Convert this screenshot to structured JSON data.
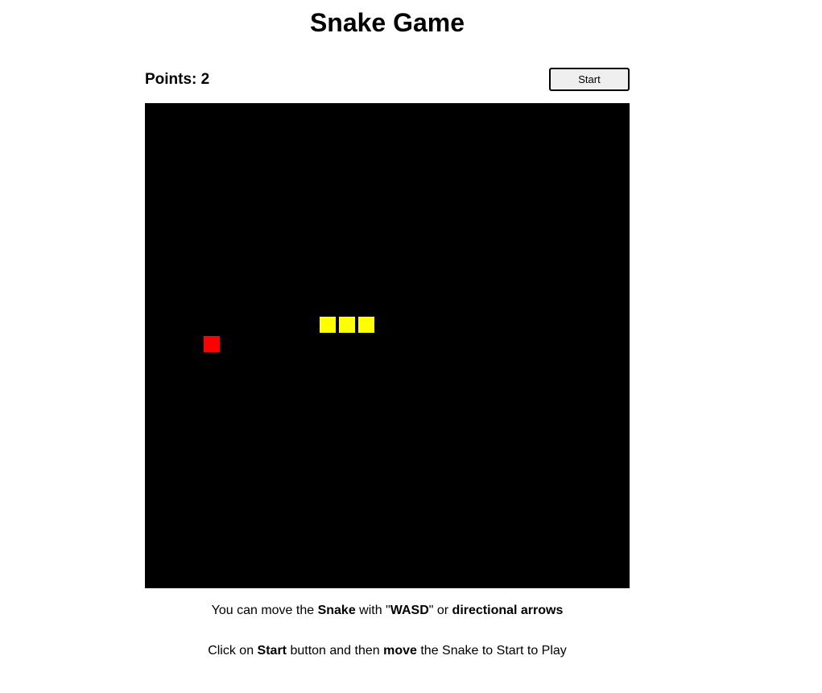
{
  "title": "Snake Game",
  "score": {
    "text": "Points: 2"
  },
  "controls": {
    "start_label": "Start"
  },
  "board": {
    "grid_cols": 25,
    "grid_rows": 25,
    "background": "#000000",
    "snake_color": "#ffff00",
    "food_color": "#ff0000",
    "snake": [
      {
        "col": 9,
        "row": 11
      },
      {
        "col": 10,
        "row": 11
      },
      {
        "col": 11,
        "row": 11
      }
    ],
    "food": {
      "col": 3,
      "row": 12
    }
  },
  "instructions": {
    "line1": {
      "t1": "You can move the ",
      "b1": "Snake",
      "t2": " with \"",
      "b2": "WASD",
      "t3": "\" or ",
      "b3": "directional arrows"
    },
    "line2": {
      "t1": "Click on ",
      "b1": "Start",
      "t2": " button and then ",
      "b2": "move",
      "t3": " the Snake to Start to Play"
    }
  }
}
